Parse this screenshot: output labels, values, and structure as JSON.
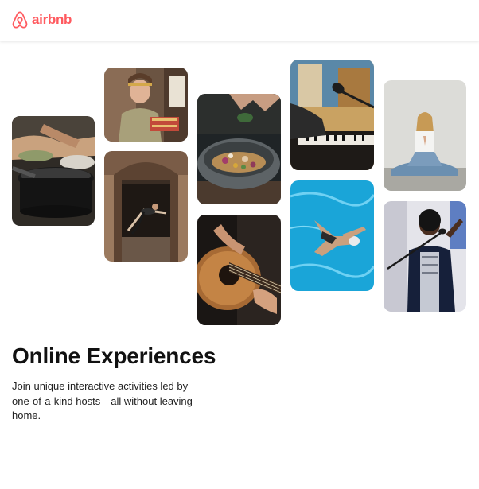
{
  "brand": {
    "name": "airbnb",
    "color": "#ff5a5f",
    "icon": "airbnb-belo-icon"
  },
  "gallery": [
    {
      "name": "photo-cooking-pans",
      "subject": "cooking"
    },
    {
      "name": "photo-woman-chef",
      "subject": "chef"
    },
    {
      "name": "photo-dancer-doorway",
      "subject": "dance"
    },
    {
      "name": "photo-food-bowl",
      "subject": "food"
    },
    {
      "name": "photo-guitar",
      "subject": "guitar"
    },
    {
      "name": "photo-piano-microphone",
      "subject": "music"
    },
    {
      "name": "photo-swimmer",
      "subject": "swimming"
    },
    {
      "name": "photo-meditation",
      "subject": "yoga"
    },
    {
      "name": "photo-singer",
      "subject": "singing"
    }
  ],
  "hero": {
    "title": "Online Experiences",
    "description": "Join unique interactive activities led by one-of-a-kind hosts—all without leaving home."
  }
}
